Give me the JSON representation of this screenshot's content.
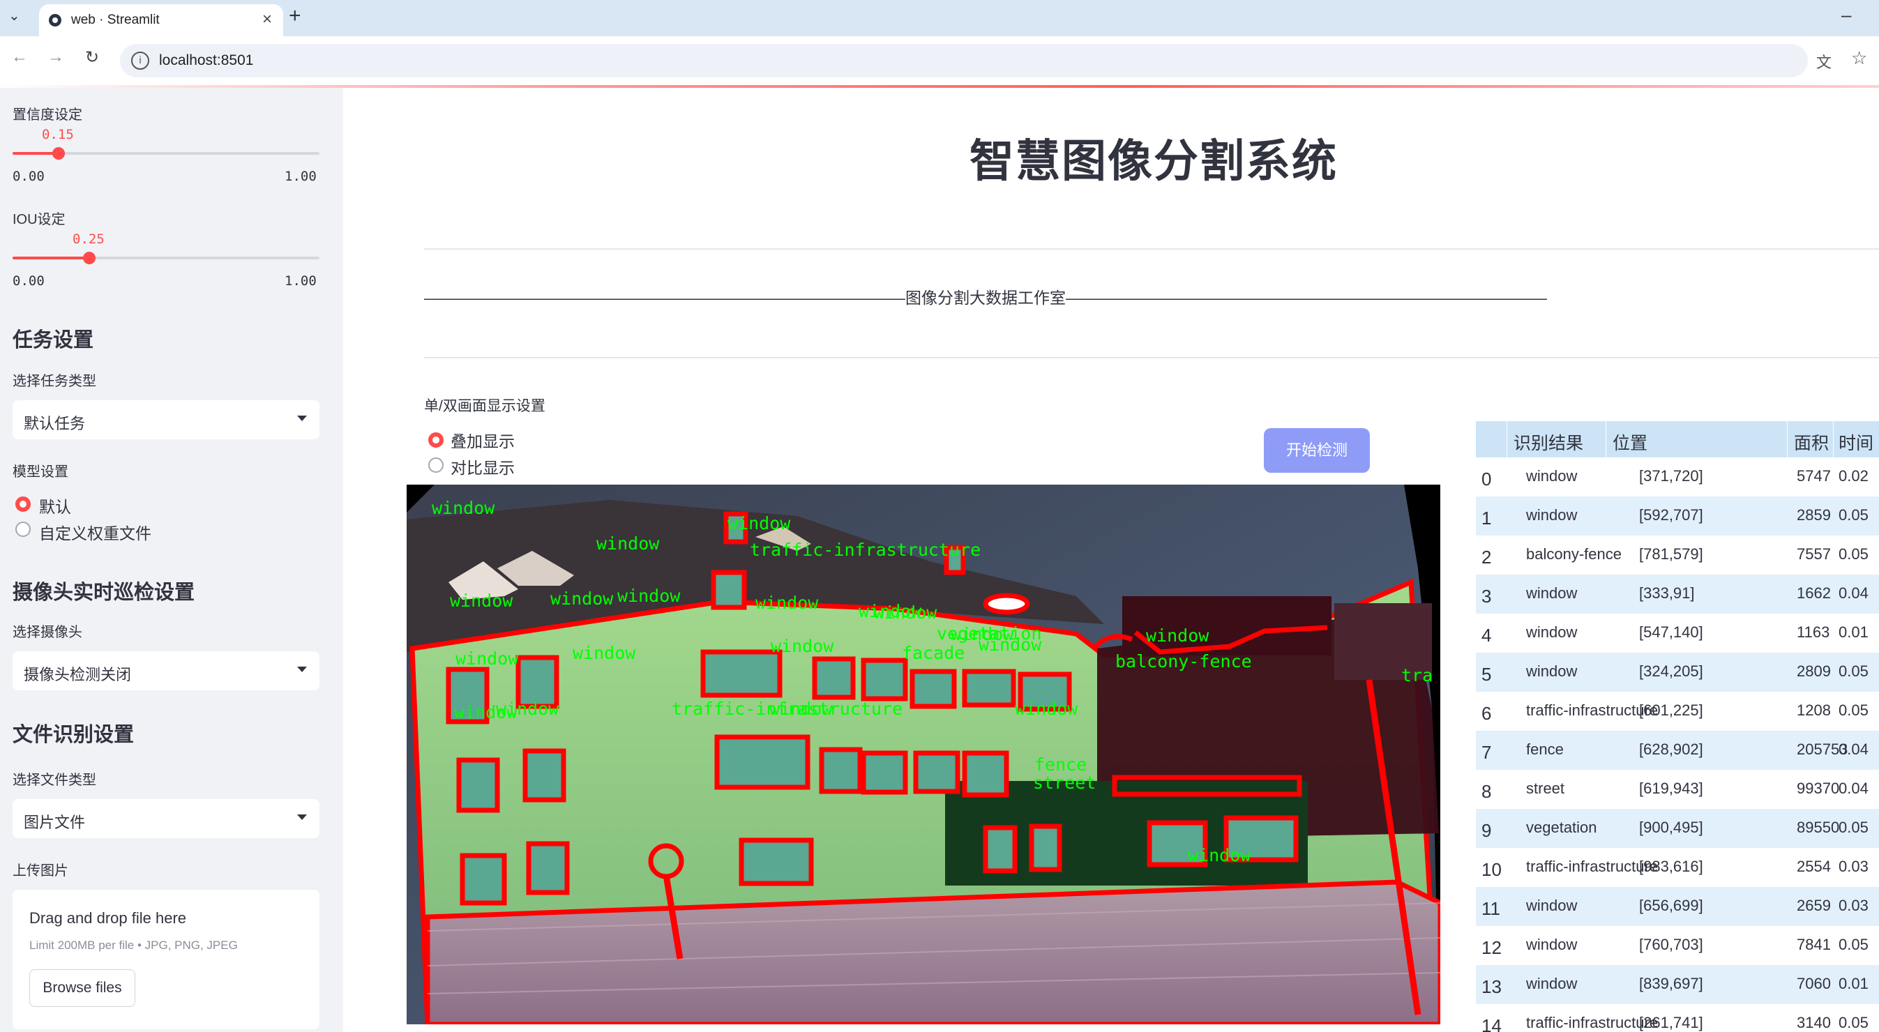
{
  "browser": {
    "tab_title": "web · Streamlit",
    "url": "localhost:8501"
  },
  "sidebar": {
    "confidence": {
      "label": "置信度设定",
      "value": "0.15",
      "min": "0.00",
      "max": "1.00",
      "fraction": 0.15
    },
    "iou": {
      "label": "IOU设定",
      "value": "0.25",
      "min": "0.00",
      "max": "1.00",
      "fraction": 0.25
    },
    "task_section": "任务设置",
    "task_type_label": "选择任务类型",
    "task_type_value": "默认任务",
    "model_label": "模型设置",
    "model_options": [
      "默认",
      "自定义权重文件"
    ],
    "camera_section": "摄像头实时巡检设置",
    "camera_label": "选择摄像头",
    "camera_value": "摄像头检测关闭",
    "file_section": "文件识别设置",
    "file_type_label": "选择文件类型",
    "file_type_value": "图片文件",
    "upload_label": "上传图片",
    "dropzone_title": "Drag and drop file here",
    "dropzone_hint": "Limit 200MB per file • JPG, PNG, JPEG",
    "browse_label": "Browse files"
  },
  "main": {
    "title": "智慧图像分割系统",
    "studio_line": "——————————————————————————————图像分割大数据工作室——————————————————————————————",
    "display_label": "单/双画面显示设置",
    "display_options": [
      "叠加显示",
      "对比显示"
    ],
    "start_button": "开始检测"
  },
  "overlay_labels": [
    {
      "text": "window"
    },
    {
      "text": "window"
    },
    {
      "text": "window"
    },
    {
      "text": "traffic-infrastructure"
    },
    {
      "text": "window"
    },
    {
      "text": "window"
    },
    {
      "text": "window"
    },
    {
      "text": "window"
    },
    {
      "text": "window"
    },
    {
      "text": "window"
    },
    {
      "text": "window"
    },
    {
      "text": "vegetation"
    },
    {
      "text": "window"
    },
    {
      "text": "window"
    },
    {
      "text": "window"
    },
    {
      "text": "facade"
    },
    {
      "text": "balcony-fence"
    },
    {
      "text": "window"
    },
    {
      "text": "traffic-infrastructure"
    },
    {
      "text": "window"
    },
    {
      "text": "window"
    },
    {
      "text": "window"
    },
    {
      "text": "window"
    },
    {
      "text": "fence"
    },
    {
      "text": "street"
    },
    {
      "text": "window"
    },
    {
      "text": "window"
    },
    {
      "text": "tra"
    }
  ],
  "table": {
    "headers": [
      "识别结果",
      "位置",
      "面积",
      "时间"
    ],
    "rows": [
      {
        "idx": "0",
        "result": "window",
        "pos": "[371,720]",
        "area": "5747",
        "time": "0.02"
      },
      {
        "idx": "1",
        "result": "window",
        "pos": "[592,707]",
        "area": "2859",
        "time": "0.05"
      },
      {
        "idx": "2",
        "result": "balcony-fence",
        "pos": "[781,579]",
        "area": "7557",
        "time": "0.05"
      },
      {
        "idx": "3",
        "result": "window",
        "pos": "[333,91]",
        "area": "1662",
        "time": "0.04"
      },
      {
        "idx": "4",
        "result": "window",
        "pos": "[547,140]",
        "area": "1163",
        "time": "0.01"
      },
      {
        "idx": "5",
        "result": "window",
        "pos": "[324,205]",
        "area": "2809",
        "time": "0.05"
      },
      {
        "idx": "6",
        "result": "traffic-infrastructure",
        "pos": "[601,225]",
        "area": "1208",
        "time": "0.05"
      },
      {
        "idx": "7",
        "result": "fence",
        "pos": "[628,902]",
        "area": "205753",
        "time": "0.04"
      },
      {
        "idx": "8",
        "result": "street",
        "pos": "[619,943]",
        "area": "99370",
        "time": "0.04"
      },
      {
        "idx": "9",
        "result": "vegetation",
        "pos": "[900,495]",
        "area": "89550",
        "time": "0.05"
      },
      {
        "idx": "10",
        "result": "traffic-infrastructure",
        "pos": "[983,616]",
        "area": "2554",
        "time": "0.03"
      },
      {
        "idx": "11",
        "result": "window",
        "pos": "[656,699]",
        "area": "2659",
        "time": "0.03"
      },
      {
        "idx": "12",
        "result": "window",
        "pos": "[760,703]",
        "area": "7841",
        "time": "0.05"
      },
      {
        "idx": "13",
        "result": "window",
        "pos": "[839,697]",
        "area": "7060",
        "time": "0.01"
      },
      {
        "idx": "14",
        "result": "traffic-infrastructure",
        "pos": "[261,741]",
        "area": "3140",
        "time": "0.05"
      }
    ]
  },
  "colors": {
    "accent": "#ff4b4b",
    "button": "#8e9cf8",
    "mask": "#ff0000",
    "label": "#00ff00"
  }
}
